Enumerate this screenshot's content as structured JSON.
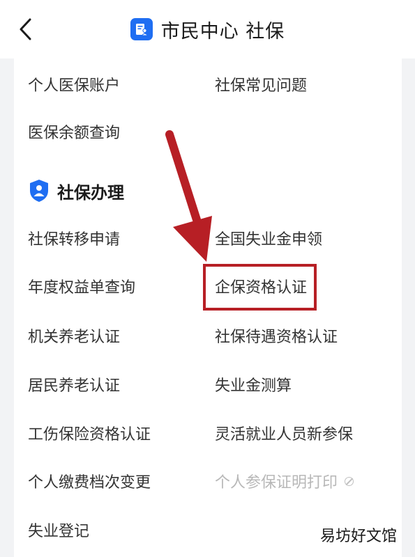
{
  "header": {
    "title": "市民中心  社保"
  },
  "top_items": [
    "个人医保账户",
    "社保常见问题",
    "医保余额查询"
  ],
  "section": {
    "title": "社保办理"
  },
  "items": {
    "left": [
      "社保转移申请",
      "年度权益单查询",
      "机关养老认证",
      "居民养老认证",
      "工伤保险资格认证",
      "个人缴费档次变更",
      "失业登记"
    ],
    "right": [
      "全国失业金申领",
      "企保资格认证",
      "社保待遇资格认证",
      "失业金测算",
      "灵活就业人员新参保",
      "个人参保证明打印"
    ]
  },
  "watermark": "易坊好文馆",
  "colors": {
    "accent": "#1f6ef2",
    "annotation": "#b71f25",
    "text": "#333333",
    "disabled_text": "#b8b8b8"
  },
  "icons": {
    "back": "chevron-left-icon",
    "app": "document-person-icon",
    "section": "shield-person-icon",
    "disabled": "prohibited-icon"
  }
}
